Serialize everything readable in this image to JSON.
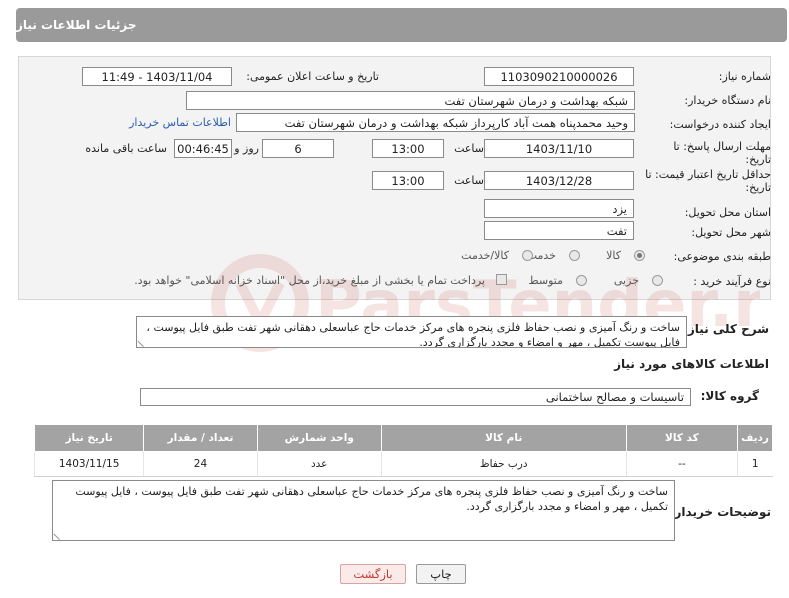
{
  "header": {
    "title": "جزئیات اطلاعات نیاز"
  },
  "form": {
    "need_number_label": "شماره نیاز:",
    "need_number": "1103090210000026",
    "announce_label": "تاریخ و ساعت اعلان عمومی:",
    "announce_value": "1403/11/04 - 11:49",
    "buyer_org_label": "نام دستگاه خریدار:",
    "buyer_org": "شبکه بهداشت و درمان شهرستان تفت",
    "creator_label": "ایجاد کننده درخواست:",
    "creator": "وحید محمدپناه همت آباد کارپرداز شبکه بهداشت و درمان شهرستان تفت",
    "contact_link": "اطلاعات تماس خریدار",
    "reply_deadline_label_1": "مهلت ارسال پاسخ: تا",
    "reply_deadline_label_2": "تاریخ:",
    "reply_date": "1403/11/10",
    "time_label": "ساعت",
    "reply_time": "13:00",
    "days_value": "6",
    "days_label": "روز و",
    "remaining_time": "00:46:45",
    "remaining_label": "ساعت باقی مانده",
    "validity_label_1": "حداقل تاریخ اعتبار قیمت: تا",
    "validity_label_2": "تاریخ:",
    "validity_date": "1403/12/28",
    "validity_time": "13:00",
    "province_label": "استان محل تحویل:",
    "province": "یزد",
    "city_label": "شهر محل تحویل:",
    "city": "تفت",
    "category_label": "طبقه بندی موضوعی:",
    "category_options": [
      "کالا",
      "خدمت",
      "کالا/خدمت"
    ],
    "category_selected": "کالا",
    "process_label": "نوع فرآیند خرید :",
    "process_options": [
      "جزیی",
      "متوسط"
    ],
    "payment_note": "پرداخت تمام یا بخشی از مبلغ خرید،از محل \"اسناد خزانه اسلامی\" خواهد بود."
  },
  "description": {
    "label": "شرح کلی نیاز:",
    "text": "ساخت و رنگ آمیزی و نصب حفاظ فلزی پنجره های مرکز خدمات حاج عباسعلی دهقانی شهر تفت طبق فایل پیوست ، فایل پیوست تکمیل ، مهر و امضاء و مجدد بارگزاری گردد."
  },
  "goods": {
    "section_title": "اطلاعات کالاهای مورد نیاز",
    "group_label": "گروه کالا:",
    "group_value": "تاسیسات و مصالح ساختمانی",
    "columns": [
      "ردیف",
      "کد کالا",
      "نام کالا",
      "واحد شمارش",
      "تعداد / مقدار",
      "تاریخ نیاز"
    ],
    "rows": [
      [
        "1",
        "--",
        "درب حفاظ",
        "عدد",
        "24",
        "1403/11/15"
      ]
    ]
  },
  "buyer_notes": {
    "label": "توضیحات خریدار:",
    "text": "ساخت و رنگ آمیزی و نصب حفاظ فلزی پنجره های مرکز خدمات حاج عباسعلی دهقانی شهر تفت طبق فایل پیوست ، فایل پیوست تکمیل ، مهر و امضاء و مجدد بارگزاری گردد."
  },
  "buttons": {
    "print": "چاپ",
    "back": "بازگشت"
  },
  "watermark": {
    "text": "ParsTender.neT"
  },
  "colors": {
    "header_bg": "#9a9a9a",
    "link": "#2a5db0",
    "back_button_text": "#c0392b"
  }
}
